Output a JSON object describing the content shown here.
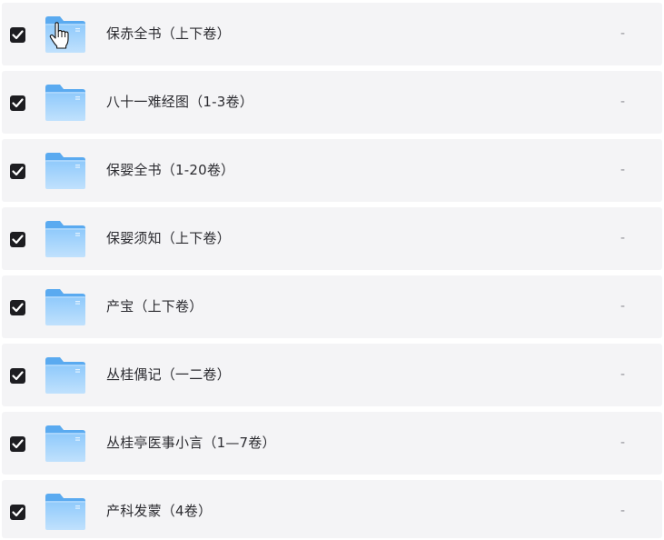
{
  "files": [
    {
      "name": "保赤全书（上下卷）",
      "size": "-",
      "checked": true
    },
    {
      "name": "八十一难经图（1-3卷）",
      "size": "-",
      "checked": true
    },
    {
      "name": "保婴全书（1-20卷）",
      "size": "-",
      "checked": true
    },
    {
      "name": "保婴须知（上下卷）",
      "size": "-",
      "checked": true
    },
    {
      "name": "产宝（上下卷）",
      "size": "-",
      "checked": true
    },
    {
      "name": "丛桂偶记（一二卷）",
      "size": "-",
      "checked": true
    },
    {
      "name": "丛桂亭医事小言（1—7卷）",
      "size": "-",
      "checked": true
    },
    {
      "name": "产科发蒙（4卷）",
      "size": "-",
      "checked": true
    }
  ],
  "icons": {
    "folder": "folder-icon",
    "checkbox": "checkbox-checked-icon",
    "cursor": "hand-pointer-icon"
  },
  "colors": {
    "row_background": "#f4f4f6",
    "checkbox": "#1d1d21",
    "folder_light": "#a9d6fb",
    "folder_dark": "#5aaaf0",
    "text": "#2b2b30",
    "muted": "#8f8f96"
  }
}
